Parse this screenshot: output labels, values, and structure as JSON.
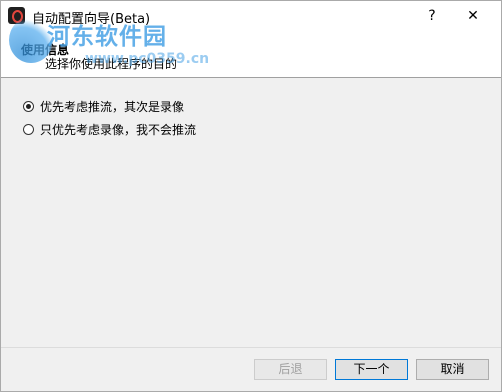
{
  "window": {
    "title": "自动配置向导(Beta)",
    "help_label": "?",
    "close_label": "✕"
  },
  "watermark": {
    "text": "河东软件园",
    "url": "www.pc0359.cn"
  },
  "header": {
    "title": "使用信息",
    "subtitle": "选择你使用此程序的目的"
  },
  "options": [
    {
      "label": "优先考虑推流，其次是录像",
      "checked": true
    },
    {
      "label": "只优先考虑录像，我不会推流",
      "checked": false
    }
  ],
  "footer": {
    "back_label": "后退",
    "back_disabled": true,
    "next_label": "下一个",
    "cancel_label": "取消"
  },
  "colors": {
    "accent": "#0078d7",
    "watermark": "#4aa3e6"
  }
}
